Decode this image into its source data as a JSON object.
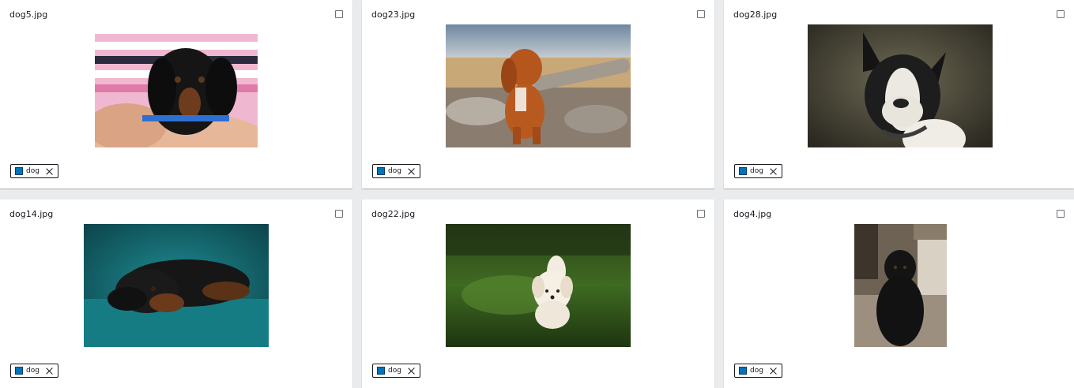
{
  "cards": [
    {
      "filename": "dog5.jpg",
      "image": "black dachshund puppy held in arms",
      "tag": {
        "label": "dog",
        "color": "#0073bb"
      }
    },
    {
      "filename": "dog23.jpg",
      "image": "red spaniel puppy sitting by a log",
      "tag": {
        "label": "dog",
        "color": "#0073bb"
      }
    },
    {
      "filename": "dog28.jpg",
      "image": "black and white boston terrier portrait",
      "tag": {
        "label": "dog",
        "color": "#0073bb"
      }
    },
    {
      "filename": "dog14.jpg",
      "image": "long-haired dachshund lying on teal background",
      "tag": {
        "label": "dog",
        "color": "#0073bb"
      }
    },
    {
      "filename": "dog22.jpg",
      "image": "white puppy walking on grass",
      "tag": {
        "label": "dog",
        "color": "#0073bb"
      }
    },
    {
      "filename": "dog4.jpg",
      "image": "black dog sitting indoors",
      "tag": {
        "label": "dog",
        "color": "#0073bb"
      }
    }
  ]
}
